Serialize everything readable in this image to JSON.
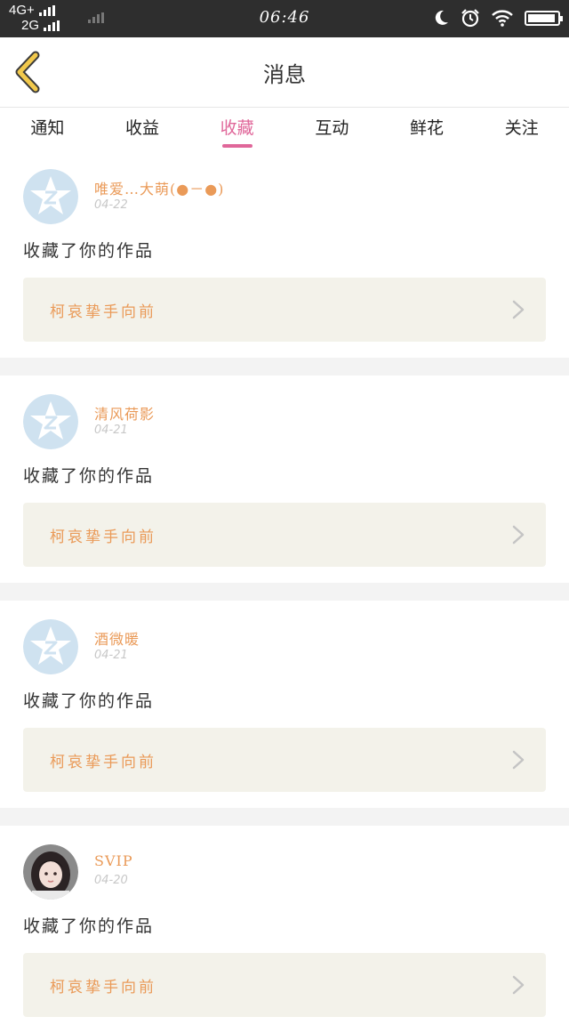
{
  "status_bar": {
    "network_top": "4G+",
    "network_bottom": "2G",
    "time": "06:46",
    "icons": [
      "moon-icon",
      "alarm-icon",
      "wifi-icon",
      "battery-icon"
    ],
    "battery_level_percent": 95
  },
  "header": {
    "title": "消息",
    "back_icon": "chevron-left-icon"
  },
  "tabs": [
    {
      "label": "通知",
      "active": false
    },
    {
      "label": "收益",
      "active": false
    },
    {
      "label": "收藏",
      "active": true
    },
    {
      "label": "互动",
      "active": false
    },
    {
      "label": "鲜花",
      "active": false
    },
    {
      "label": "关注",
      "active": false
    }
  ],
  "messages": [
    {
      "user": "唯爱…大萌(●－●)",
      "date": "04-22",
      "action": "收藏了你的作品",
      "work_title": "柯哀挚手向前",
      "avatar": "default-star-avatar"
    },
    {
      "user": "清风荷影",
      "date": "04-21",
      "action": "收藏了你的作品",
      "work_title": "柯哀挚手向前",
      "avatar": "default-star-avatar"
    },
    {
      "user": "酒微暖",
      "date": "04-21",
      "action": "收藏了你的作品",
      "work_title": "柯哀挚手向前",
      "avatar": "default-star-avatar"
    },
    {
      "user": "SVIP",
      "date": "04-20",
      "action": "收藏了你的作品",
      "work_title": "柯哀挚手向前",
      "avatar": "photo-avatar"
    }
  ],
  "colors": {
    "accent_pink": "#e0679a",
    "orange_text": "#ea9a58",
    "back_icon_yellow": "#f2c94c",
    "card_bg": "#f3f2ea",
    "status_bar_bg": "#2e2e2e"
  }
}
